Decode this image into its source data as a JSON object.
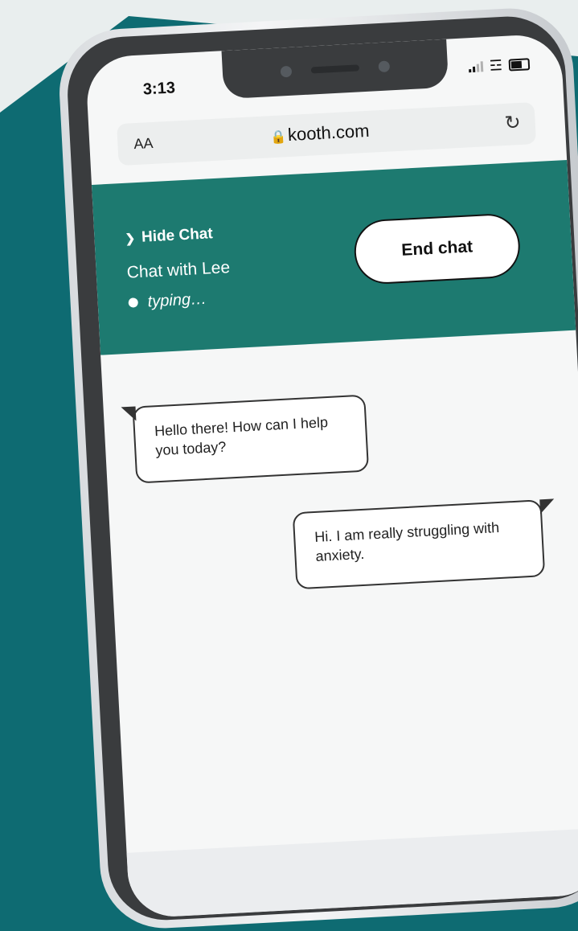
{
  "status_bar": {
    "time": "3:13"
  },
  "browser": {
    "text_size_label": "AA",
    "url": "kooth.com"
  },
  "chat_header": {
    "hide_chat_label": "Hide Chat",
    "chat_with": "Chat with Lee",
    "status": "typing…",
    "end_chat_label": "End chat"
  },
  "messages": [
    {
      "from": "counsellor",
      "text": "Hello there! How can I help you today?"
    },
    {
      "from": "user",
      "text": "Hi. I am really struggling with anxiety."
    }
  ],
  "colors": {
    "header_green": "#1d7a70",
    "background_teal": "#0e6b72"
  },
  "icons": [
    "lock-icon",
    "reload-icon",
    "chevron-down-icon",
    "signal-icon",
    "wifi-icon",
    "battery-icon"
  ]
}
